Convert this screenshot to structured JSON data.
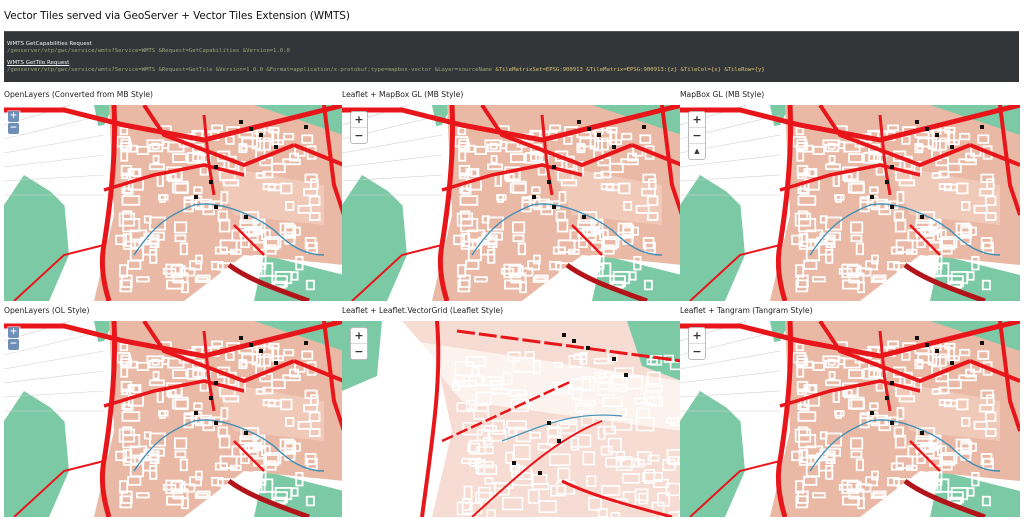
{
  "page": {
    "title": "Vector Tiles served via GeoServer + Vector Tiles Extension (WMTS)"
  },
  "requests": {
    "capabilities_label": "WMTS GetCapabilities Request",
    "capabilities_url": "/geoserver/vtp/gwc/service/wmts?Service=WMTS &Request=GetCapabilities &Version=1.0.0",
    "tile_label": "WMTS GetTile Request",
    "tile_url_a": "/geoserver/vtp/gwc/service/wmts?Service=WMTS &Request=GetTile &Version=1.0.0 &Format=application/x-protobuf;type=mapbox-vector &Layer=sourceName ",
    "tile_url_b": "&TileMatrixSet=EPSG:900913 &TileMatrix=EPSG:900913:{z} &TileCol={x} &TileRow={y}"
  },
  "panels": [
    {
      "title": "OpenLayers (Converted from MB Style)",
      "controls": "ol",
      "zoom_in": "+",
      "zoom_out": "−"
    },
    {
      "title": "Leaflet + MapBox GL (MB Style)",
      "controls": "leaflet",
      "zoom_in": "+",
      "zoom_out": "−"
    },
    {
      "title": "MapBox GL (MB Style)",
      "controls": "leaflet",
      "zoom_in": "+",
      "zoom_out": "−",
      "compass": "▲"
    },
    {
      "title": "OpenLayers (OL Style)",
      "controls": "ol",
      "zoom_in": "+",
      "zoom_out": "−"
    },
    {
      "title": "Leaflet + Leaflet.VectorGrid (Leaflet Style)",
      "controls": "leaflet",
      "zoom_in": "+",
      "zoom_out": "−"
    },
    {
      "title": "Leaflet + Tangram (Tangram Style)",
      "controls": "leaflet",
      "zoom_in": "+",
      "zoom_out": "−"
    }
  ],
  "colors": {
    "road_major": "#e8161a",
    "road_minor": "#ffffff",
    "landuse": "#e9b9a5",
    "park": "#7ccaa5",
    "water": "#3e8fb8",
    "building": "#111111",
    "code_bg": "#333638",
    "control_ol": "#6f8fb8"
  }
}
